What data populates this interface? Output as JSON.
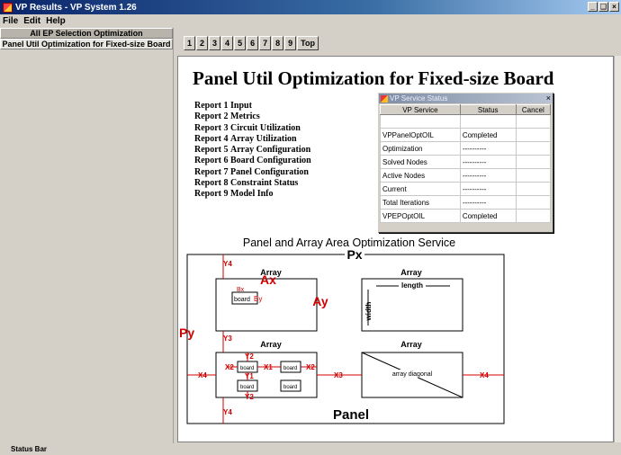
{
  "window": {
    "title": "VP Results - VP System 1.26",
    "buttons": [
      "_",
      "❑",
      "×"
    ]
  },
  "menu": [
    "File",
    "Edit",
    "Help"
  ],
  "left_panel": {
    "items": [
      "All EP Selection Optimization",
      "Panel Util Optimization for Fixed-size Board"
    ]
  },
  "nav_buttons": [
    "1",
    "2",
    "3",
    "4",
    "5",
    "6",
    "7",
    "8",
    "9",
    "Top"
  ],
  "report": {
    "title": "Panel Util Optimization for Fixed-size Board",
    "rows": [
      {
        "num": "Report 1",
        "label": "Input"
      },
      {
        "num": "Report 2",
        "label": "Metrics"
      },
      {
        "num": "Report 3",
        "label": "Circuit Utilization"
      },
      {
        "num": "Report 4",
        "label": "Array Utilization"
      },
      {
        "num": "Report 5",
        "label": "Array Configuration"
      },
      {
        "num": "Report 6",
        "label": "Board Configuration"
      },
      {
        "num": "Report 7",
        "label": "Panel Configuration"
      },
      {
        "num": "Report 8",
        "label": "Constraint Status"
      },
      {
        "num": "Report 9",
        "label": "Model Info"
      }
    ]
  },
  "dialog": {
    "title": "VP Service Status",
    "close": "×",
    "columns": [
      "VP Service",
      "Status",
      "Cancel"
    ],
    "rows": [
      [
        "",
        "",
        ""
      ],
      [
        "VPPanelOptOIL",
        "Completed",
        ""
      ],
      [
        "Optimization",
        "----------",
        ""
      ],
      [
        "Solved Nodes",
        "----------",
        ""
      ],
      [
        "Active Nodes",
        "----------",
        ""
      ],
      [
        "Current",
        "----------",
        ""
      ],
      [
        "Total Iterations",
        "----------",
        ""
      ],
      [
        "VPEPOptOIL",
        "Completed",
        ""
      ]
    ]
  },
  "diagram": {
    "title": "Panel and Array Area Optimization Service",
    "px": "Px",
    "py": "Py",
    "ax": "Ax",
    "ay": "Ay",
    "bx": "Bx",
    "by": "By",
    "board": "board",
    "array": "Array",
    "length": "length",
    "width": "width",
    "array_diagonal": "array diagonal",
    "panel": "Panel",
    "x1": "X1",
    "x2": "X2",
    "x3": "X3",
    "x4": "X4",
    "y1": "Y1",
    "y2": "Y2",
    "y3": "Y3",
    "y4": "Y4"
  },
  "status_bar": "Status Bar",
  "colors": {
    "title_bar": "#0a246a",
    "diagram_red": "#d00000"
  }
}
